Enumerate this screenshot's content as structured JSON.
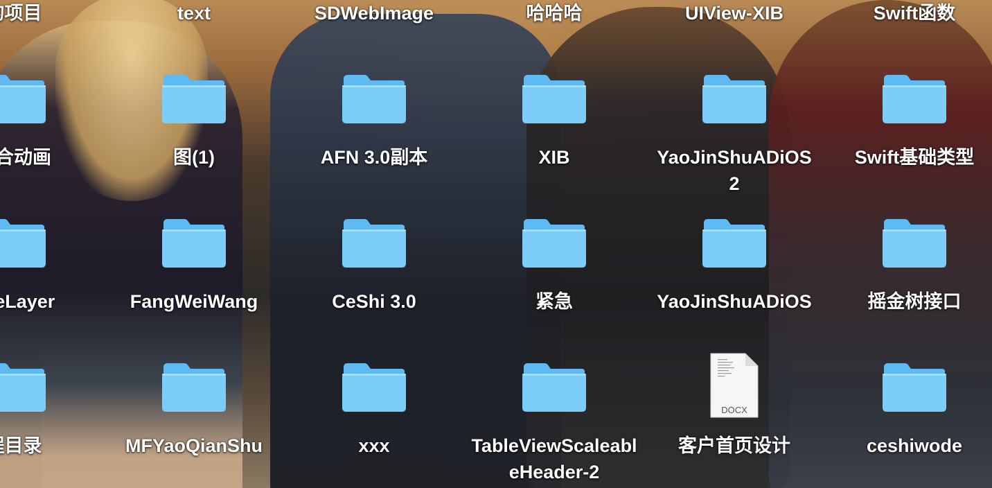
{
  "colors": {
    "folder_back": "#5fb9f2",
    "folder_front": "#7dcdfa",
    "folder_highlight": "#a6def9",
    "label_text": "#ffffff",
    "doc_paper": "#f6f6f6"
  },
  "top_row": [
    {
      "label": "的项目"
    },
    {
      "label": "text"
    },
    {
      "label": "SDWebImage"
    },
    {
      "label": "哈哈哈"
    },
    {
      "label": "UIView-XIB"
    },
    {
      "label": "Swift函数"
    }
  ],
  "rows": [
    [
      {
        "label": "组合动画",
        "icon": "folder-icon"
      },
      {
        "label": "图(1)",
        "icon": "folder-icon"
      },
      {
        "label": "AFN 3.0副本",
        "icon": "folder-icon"
      },
      {
        "label": "XIB",
        "icon": "folder-icon"
      },
      {
        "label": "YaoJinShuADiOS 2",
        "icon": "folder-icon"
      },
      {
        "label": "Swift基础类型",
        "icon": "folder-icon"
      }
    ],
    [
      {
        "label": "apeLayer",
        "icon": "folder-icon"
      },
      {
        "label": "FangWeiWang",
        "icon": "folder-icon"
      },
      {
        "label": "CeShi 3.0",
        "icon": "folder-icon"
      },
      {
        "label": "紧急",
        "icon": "folder-icon"
      },
      {
        "label": "YaoJinShuADiOS",
        "icon": "folder-icon"
      },
      {
        "label": "摇金树接口",
        "icon": "folder-icon"
      }
    ],
    [
      {
        "label": "程目录",
        "icon": "folder-icon"
      },
      {
        "label": "MFYaoQianShu",
        "icon": "folder-icon"
      },
      {
        "label": "xxx",
        "icon": "folder-icon"
      },
      {
        "label": "TableViewScaleableHeader-2",
        "icon": "folder-icon"
      },
      {
        "label": "客户首页设计",
        "icon": "docx-icon",
        "file_type": "DOCX"
      },
      {
        "label": "ceshiwode",
        "icon": "folder-icon"
      }
    ]
  ]
}
